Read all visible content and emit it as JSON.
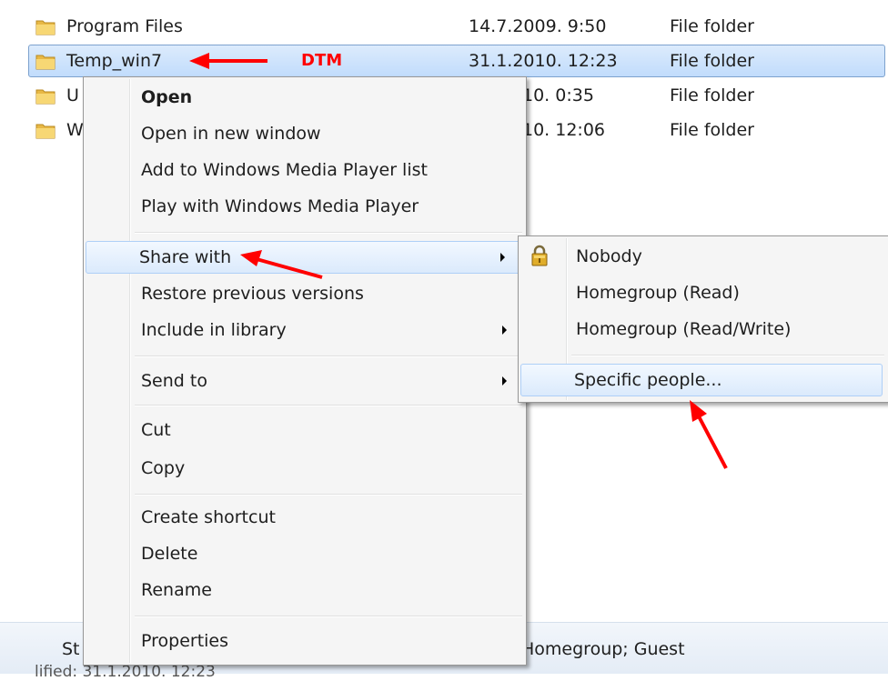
{
  "files": [
    {
      "name": "Program Files",
      "date": "14.7.2009. 9:50",
      "type": "File folder"
    },
    {
      "name": "Temp_win7",
      "date": "31.1.2010. 12:23",
      "type": "File folder"
    },
    {
      "name": "U",
      "date": "10. 0:35",
      "type": "File folder"
    },
    {
      "name": "W",
      "date": "10. 12:06",
      "type": "File folder"
    }
  ],
  "annotation": {
    "dtm_label": "DTM"
  },
  "context_menu": {
    "open": "Open",
    "open_new_window": "Open in new window",
    "add_wmp_list": "Add to Windows Media Player list",
    "play_wmp": "Play with Windows Media Player",
    "share_with": "Share with",
    "restore_previous": "Restore previous versions",
    "include_library": "Include in library",
    "send_to": "Send to",
    "cut": "Cut",
    "copy": "Copy",
    "create_shortcut": "Create shortcut",
    "delete": "Delete",
    "rename": "Rename",
    "properties": "Properties"
  },
  "share_submenu": {
    "nobody": "Nobody",
    "homegroup_read": "Homegroup (Read)",
    "homegroup_readwrite": "Homegroup (Read/Write)",
    "specific_people": "Specific people..."
  },
  "status_bar": {
    "left_text": "St",
    "right_text": "Homegroup; Guest",
    "second_line": "lified: 31.1.2010. 12:23"
  },
  "colors": {
    "annotation_red": "#ff0000",
    "selection_border": "#7da2ce"
  }
}
